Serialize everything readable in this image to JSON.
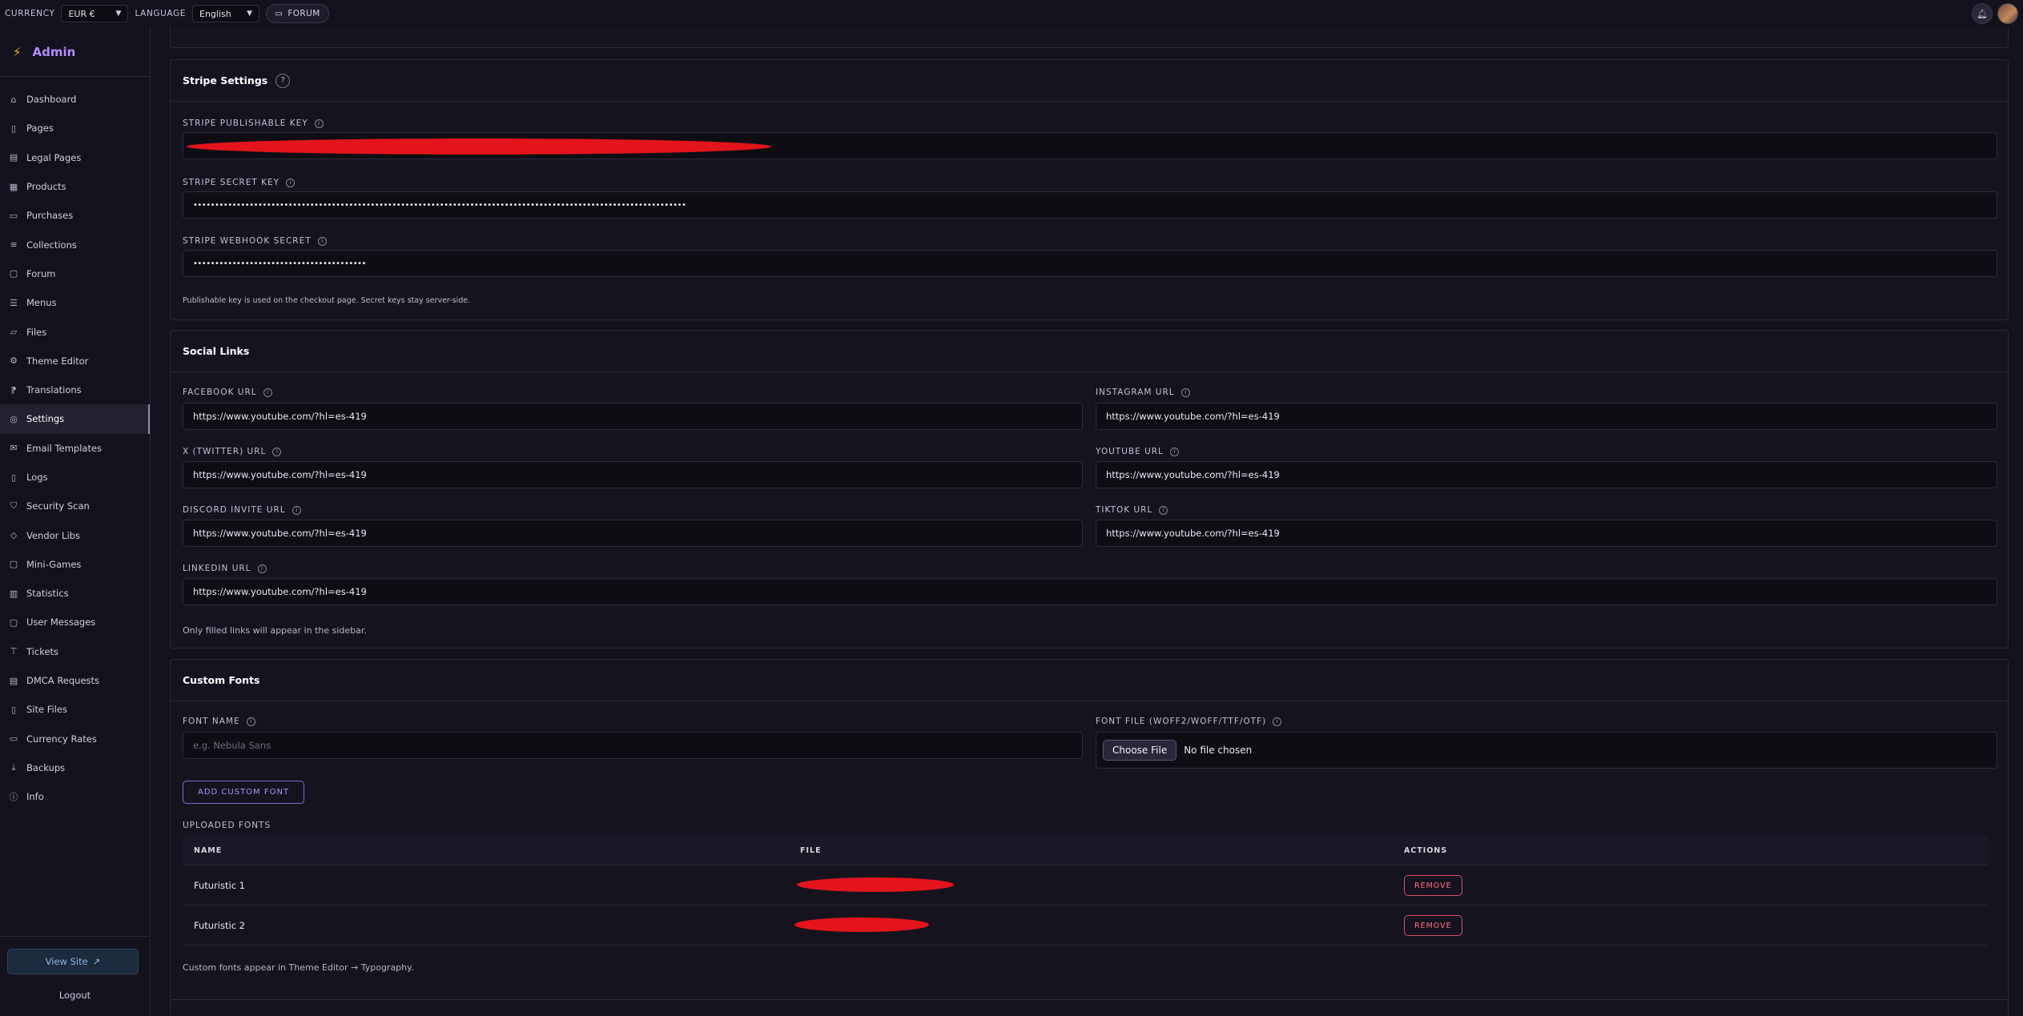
{
  "topbar": {
    "currency_label": "CURRENCY",
    "currency_value": "EUR €",
    "language_label": "LANGUAGE",
    "language_value": "English",
    "forum_label": "FORUM"
  },
  "sidebar": {
    "brand": "Admin",
    "items": [
      {
        "label": "Dashboard",
        "icon": "home-icon"
      },
      {
        "label": "Pages",
        "icon": "file-icon"
      },
      {
        "label": "Legal Pages",
        "icon": "document-icon"
      },
      {
        "label": "Products",
        "icon": "grid-icon"
      },
      {
        "label": "Purchases",
        "icon": "receipt-icon"
      },
      {
        "label": "Collections",
        "icon": "list-icon"
      },
      {
        "label": "Forum",
        "icon": "chat-icon"
      },
      {
        "label": "Menus",
        "icon": "menu-icon"
      },
      {
        "label": "Files",
        "icon": "folder-icon"
      },
      {
        "label": "Theme Editor",
        "icon": "gear-icon"
      },
      {
        "label": "Translations",
        "icon": "translate-icon"
      },
      {
        "label": "Settings",
        "icon": "settings-icon"
      },
      {
        "label": "Email Templates",
        "icon": "mail-icon"
      },
      {
        "label": "Logs",
        "icon": "log-icon"
      },
      {
        "label": "Security Scan",
        "icon": "shield-icon"
      },
      {
        "label": "Vendor Libs",
        "icon": "diamond-icon"
      },
      {
        "label": "Mini-Games",
        "icon": "gamepad-icon"
      },
      {
        "label": "Statistics",
        "icon": "bar-chart-icon"
      },
      {
        "label": "User Messages",
        "icon": "message-icon"
      },
      {
        "label": "Tickets",
        "icon": "ticket-icon"
      },
      {
        "label": "DMCA Requests",
        "icon": "dmca-icon"
      },
      {
        "label": "Site Files",
        "icon": "site-file-icon"
      },
      {
        "label": "Currency Rates",
        "icon": "currency-icon"
      },
      {
        "label": "Backups",
        "icon": "download-icon"
      },
      {
        "label": "Info",
        "icon": "info-icon"
      }
    ],
    "active_item": "Settings",
    "view_site": "View Site",
    "logout": "Logout"
  },
  "stripe": {
    "title": "Stripe Settings",
    "publishable_label": "STRIPE PUBLISHABLE KEY",
    "secret_label": "STRIPE SECRET KEY",
    "secret_value": "••••••••••••••••••••••••••••••••••••••••••••••••••••••••••••••••••••••••••••••••••••••••••••••••••••••••••••••••••",
    "webhook_label": "STRIPE WEBHOOK SECRET",
    "webhook_value": "••••••••••••••••••••••••••••••••••••••••",
    "hint": "Publishable key is used on the checkout page. Secret keys stay server-side."
  },
  "social": {
    "title": "Social Links",
    "facebook_label": "FACEBOOK URL",
    "facebook_value": "https://www.youtube.com/?hl=es-419",
    "instagram_label": "INSTAGRAM URL",
    "instagram_value": "https://www.youtube.com/?hl=es-419",
    "twitter_label": "X (TWITTER) URL",
    "twitter_value": "https://www.youtube.com/?hl=es-419",
    "youtube_label": "YOUTUBE URL",
    "youtube_value": "https://www.youtube.com/?hl=es-419",
    "discord_label": "DISCORD INVITE URL",
    "discord_value": "https://www.youtube.com/?hl=es-419",
    "tiktok_label": "TIKTOK URL",
    "tiktok_value": "https://www.youtube.com/?hl=es-419",
    "linkedin_label": "LINKEDIN URL",
    "linkedin_value": "https://www.youtube.com/?hl=es-419",
    "hint": "Only filled links will appear in the sidebar."
  },
  "fonts": {
    "title": "Custom Fonts",
    "font_name_label": "FONT NAME",
    "font_name_placeholder": "e.g. Nebula Sans",
    "font_file_label": "FONT FILE (WOFF2/WOFF/TTF/OTF)",
    "choose_file": "Choose File",
    "no_file": "No file chosen",
    "add_button": "ADD CUSTOM FONT",
    "uploaded_label": "UPLOADED FONTS",
    "columns": [
      "NAME",
      "FILE",
      "ACTIONS"
    ],
    "rows": [
      {
        "name": "Futuristic 1",
        "action": "REMOVE"
      },
      {
        "name": "Futuristic 2",
        "action": "REMOVE"
      }
    ],
    "hint": "Custom fonts appear in Theme Editor → Typography."
  }
}
